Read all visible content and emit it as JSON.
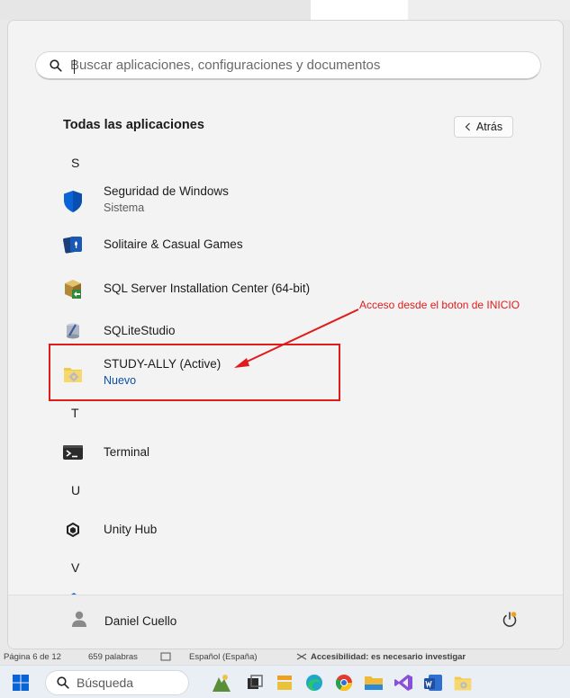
{
  "search": {
    "placeholder": "Buscar aplicaciones, configuraciones y documentos"
  },
  "all_apps": {
    "title": "Todas las aplicaciones",
    "back_label": "Atrás"
  },
  "letters": {
    "s": "S",
    "t": "T",
    "u": "U",
    "v": "V"
  },
  "apps": [
    {
      "name": "Seguridad de Windows",
      "sub": "Sistema",
      "icon": "windows-security-shield-icon"
    },
    {
      "name": "Solitaire & Casual Games",
      "icon": "solitaire-cards-icon"
    },
    {
      "name": "SQL Server Installation Center (64-bit)",
      "icon": "sql-server-setup-icon"
    },
    {
      "name": "SQLiteStudio",
      "icon": "sqlitestudio-icon"
    },
    {
      "name": "STUDY-ALLY (Active)",
      "badge": "Nuevo",
      "icon": "study-ally-app-icon"
    },
    {
      "name": "Terminal",
      "icon": "terminal-icon"
    },
    {
      "name": "Unity Hub",
      "icon": "unity-hub-icon"
    }
  ],
  "user": {
    "name": "Daniel Cuello"
  },
  "annotation": {
    "text": "Acceso desde el boton de INICIO",
    "color": "#e01b1b"
  },
  "status_bar": {
    "page": "Página 6 de 12",
    "words": "659 palabras",
    "language": "Español (España)",
    "accessibility": "Accesibilidad: es necesario investigar"
  },
  "taskbar": {
    "search_label": "Búsqueda"
  },
  "colors": {
    "accent": "#0f4ea5",
    "panel_bg": "#f3f3f3",
    "annotation": "#e01b1b"
  }
}
